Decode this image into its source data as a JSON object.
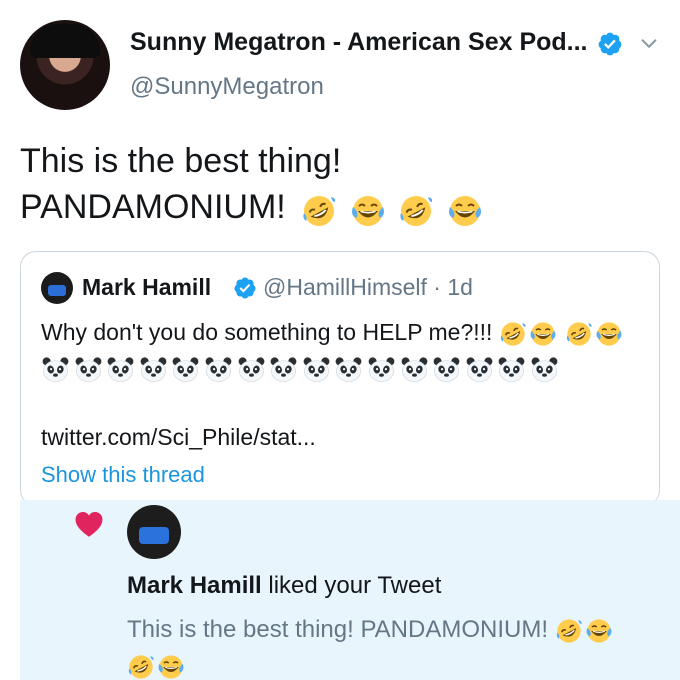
{
  "tweet": {
    "display_name": "Sunny Megatron - American Sex Pod...",
    "handle": "@SunnyMegatron",
    "text_line1": "This is the best thing!",
    "text_line2": "PANDAMONIUM!",
    "emojis": [
      "rofl-emoji",
      "joy-emoji",
      "rofl-emoji",
      "joy-emoji"
    ]
  },
  "quote": {
    "name": "Mark Hamill",
    "handle_time": "@HamillHimself · 1d",
    "text": "Why don't you do something to HELP me?!!!",
    "panda_count": 16,
    "link": "twitter.com/Sci_Phile/stat...",
    "show_thread": "Show this thread"
  },
  "notification": {
    "liker": "Mark Hamill",
    "action": " liked your Tweet",
    "tweet_text": "This is the best thing! PANDAMONIUM!"
  },
  "colors": {
    "verified": "#1da1f2",
    "link": "#1b95e0",
    "heart": "#e0245e",
    "notification_bg": "#e8f5fd",
    "muted": "#657786"
  }
}
